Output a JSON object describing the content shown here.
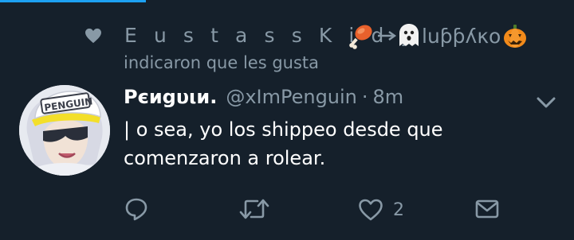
{
  "social_context": {
    "user_name": "E u s t a s s  K i d y",
    "nickname_tail": "luƥƥʎκο",
    "action": "indicaron que les gusta"
  },
  "tweet": {
    "author_name": "Pєиgυιи.",
    "handle": "@xImPenguin",
    "separator": "·",
    "time": "8m",
    "text_lines": [
      "| o sea, yo los shippeo desde que",
      "comenzaron a rolear."
    ]
  },
  "actions": {
    "like_count": "2"
  },
  "colors": {
    "background": "#15202b",
    "secondary_text": "#8899a6",
    "primary_text": "#ffffff",
    "accent": "#1da1f2"
  },
  "icons": [
    "heart-icon",
    "drumstick-emoji",
    "arrow-icon",
    "ghost-emoji",
    "pumpkin-emoji",
    "chevron-down-icon",
    "reply-icon",
    "retweet-icon",
    "like-icon",
    "message-icon"
  ]
}
